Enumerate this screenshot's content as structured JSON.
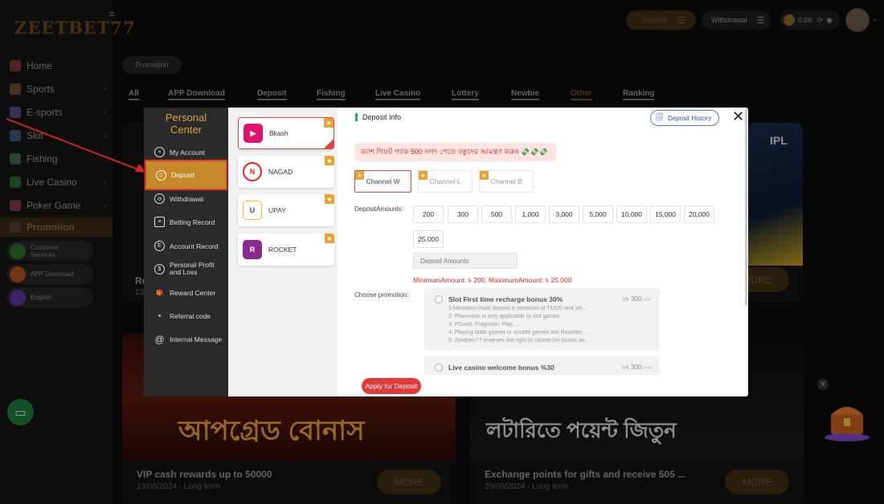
{
  "site": {
    "logo_text": "ZEETBET77",
    "menu_icon": "hamburger-icon",
    "topbar": {
      "deposit_label": "Deposit",
      "withdrawal_label": "Withdrawal",
      "balance": "0.00"
    },
    "sidebar": {
      "items": [
        {
          "label": "Home",
          "icon": "home-icon"
        },
        {
          "label": "Sports",
          "icon": "sports-icon"
        },
        {
          "label": "E-sports",
          "icon": "esports-icon"
        },
        {
          "label": "Slot",
          "icon": "slot-icon"
        },
        {
          "label": "Fishing",
          "icon": "fishing-icon"
        },
        {
          "label": "Live Casino",
          "icon": "live-casino-icon"
        },
        {
          "label": "Poker Game",
          "icon": "poker-icon"
        },
        {
          "label": "Promotion",
          "icon": "promotion-icon"
        }
      ],
      "pills": [
        {
          "label": "Customer Services",
          "color": "#2f6e2c"
        },
        {
          "label": "APP Download",
          "color": "#b3521f"
        },
        {
          "label": "English",
          "color": "#5b3aa0"
        }
      ]
    },
    "promo_tag": "Promotion",
    "tabs": [
      "All",
      "APP Download",
      "Deposit",
      "Fishing",
      "Live Casino",
      "Lottery",
      "Newbie",
      "Other",
      "Ranking"
    ],
    "cards": [
      {
        "title": "VIP cash rewards up to 50000",
        "date": "19/06/2024 - Long term",
        "more": "MORE",
        "banner_text": "আপগ্রেড বোনাস"
      },
      {
        "title": "Exchange points for gifts and receive 505 ...",
        "date": "29/06/2024 - Long term",
        "more": "MORE",
        "banner_text": "লটারিতে পয়েন্ট জিতুন"
      }
    ],
    "partial_cards": [
      {
        "title": "Ro",
        "date": "13",
        "more": "MORE"
      },
      {
        "more": "MORE"
      }
    ]
  },
  "modal": {
    "title_line1": "Personal",
    "title_line2": "Center",
    "nav": [
      {
        "label": "My Account",
        "icon": "account-icon"
      },
      {
        "label": "Deposit",
        "icon": "deposit-icon"
      },
      {
        "label": "Withdrawal",
        "icon": "withdrawal-icon"
      },
      {
        "label": "Betting Record",
        "icon": "betting-record-icon"
      },
      {
        "label": "Account Record",
        "icon": "account-record-icon"
      },
      {
        "label": "Personal Profit and Loss",
        "icon": "profit-loss-icon"
      },
      {
        "label": "Reward Center",
        "icon": "reward-icon"
      },
      {
        "label": "Referral code",
        "icon": "referral-icon"
      },
      {
        "label": "Internal Message",
        "icon": "message-icon"
      }
    ],
    "payment_methods": [
      {
        "name": "Bkash",
        "color": "#e2136e",
        "icon": "bkash-logo-icon"
      },
      {
        "name": "NAGAD",
        "color": "#ec1c24",
        "icon": "nagad-logo-icon"
      },
      {
        "name": "UPAY",
        "color": "#1f4fa3",
        "icon": "upay-logo-icon"
      },
      {
        "name": "ROCKET",
        "color": "#8a2a8c",
        "icon": "rocket-logo-icon"
      }
    ],
    "content": {
      "header": "Deposit Info",
      "history_button": "Deposit History",
      "notice": "ক্যাশ গিফট প্যাক 500 নগদ পেতে বন্ধুদের আমন্ত্রণ করুন 💸💸💸",
      "channels": [
        "Channel W",
        "Channel L",
        "Channel B"
      ],
      "amount_label": "DepositAmounts:",
      "amounts": [
        "200",
        "300",
        "500",
        "1,000",
        "3,000",
        "5,000",
        "10,000",
        "15,000",
        "20,000",
        "25,000"
      ],
      "amount_placeholder": "Deposit Amounts",
      "min_text": "MinimumAmount: ৳ 200",
      "max_text": "MaximumAmount: ৳ 25,000",
      "promotion_label": "Choose promotion:",
      "promotions": [
        {
          "title": "Slot First time recharge bonus 30%",
          "amount": "২৳ 300.০০",
          "lines": [
            "1:Members must deposit a minimum of Tk300 and sel...",
            "2: Promotion is only applicable to slot games",
            "3: PGsoft, Fragmatic Play, ...",
            "4: Playing table games or arcade games like Roulette, ...",
            "5: Zeetben77 reserves the right to cancel the bonus an..."
          ]
        },
        {
          "title": "Live casino welcome bonus %30",
          "amount": "২৳ 300.০০",
          "lines": []
        }
      ],
      "apply_button": "Apply for Deposit"
    }
  }
}
